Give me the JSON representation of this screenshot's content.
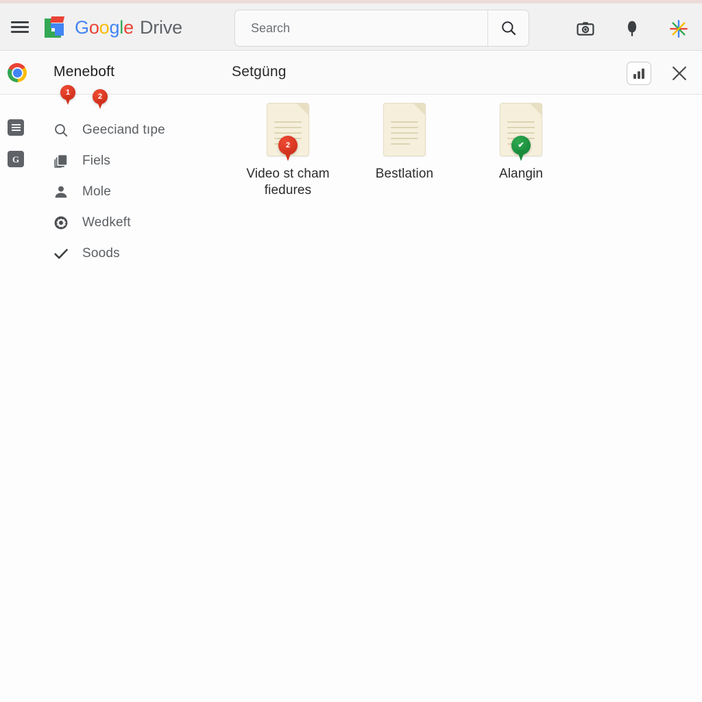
{
  "window": {
    "background_color": "#fdfdfd",
    "top_edge_color": "#e9d6d2"
  },
  "topbar": {
    "background_color": "#f1f1f1",
    "menu_icon": "hamburger-icon",
    "brand": {
      "logo_icon": "google-g-logo",
      "word_google": [
        "G",
        "o",
        "o",
        "g",
        "l",
        "e"
      ],
      "product": "Drive"
    },
    "search": {
      "value": "",
      "placeholder": "Search",
      "button_icon": "search-icon"
    },
    "actions": [
      {
        "icon": "camera-icon",
        "label": "Camera"
      },
      {
        "icon": "microphone-icon",
        "label": "Microphone"
      },
      {
        "icon": "gemini-sparkle-icon",
        "label": "Gemini"
      }
    ]
  },
  "subbar": {
    "background_color": "#fbfafa",
    "app_icon": "chrome-icon",
    "tabs": [
      {
        "label": "Meneboft"
      },
      {
        "label": "Setgüng"
      }
    ],
    "chart_button_icon": "bar-chart-icon",
    "close_button_icon": "close-icon"
  },
  "markers": [
    {
      "id": "pin-1",
      "label": "1",
      "color": "#d2321d"
    },
    {
      "id": "pin-2",
      "label": "2",
      "color": "#d2321d"
    }
  ],
  "rail": {
    "items": [
      {
        "icon": "list-square-icon",
        "label": ""
      },
      {
        "icon": "g-square-icon",
        "label": "G"
      }
    ]
  },
  "sidebar": {
    "items": [
      {
        "label": "Geeciand tıpe",
        "icon": "search-icon"
      },
      {
        "label": "Fiels",
        "icon": "copy-layers-icon"
      },
      {
        "label": "Mole",
        "icon": "person-icon"
      },
      {
        "label": "Wedkeft",
        "icon": "gear-icon"
      },
      {
        "label": "Soods",
        "icon": "check-icon"
      }
    ]
  },
  "files": [
    {
      "name": "Video st cham fiedures",
      "icon": "document-icon",
      "badge": {
        "type": "pin",
        "label": "2",
        "color": "#d2321d"
      }
    },
    {
      "name": "Bestlation",
      "icon": "document-icon",
      "badge": null
    },
    {
      "name": "Alangin",
      "icon": "document-icon",
      "badge": {
        "type": "pin",
        "label": "✔",
        "color": "#198c3c"
      }
    }
  ]
}
